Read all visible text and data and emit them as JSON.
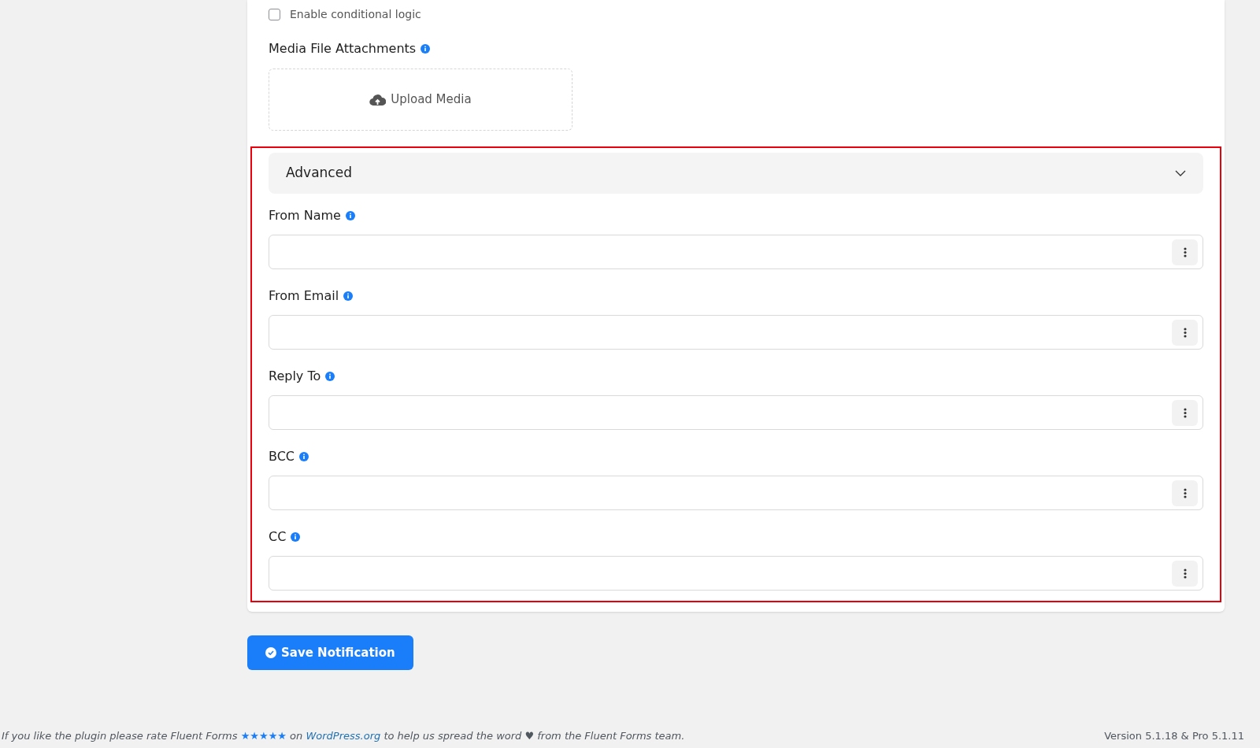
{
  "conditional_logic": {
    "label": "Enable conditional logic",
    "checked": false
  },
  "media_attachments": {
    "label": "Media File Attachments",
    "upload_button": "Upload Media"
  },
  "advanced": {
    "title": "Advanced",
    "expanded": true,
    "fields": [
      {
        "label": "From Name"
      },
      {
        "label": "From Email"
      },
      {
        "label": "Reply To"
      },
      {
        "label": "BCC"
      },
      {
        "label": "CC"
      }
    ]
  },
  "save_button": "Save Notification",
  "footer": {
    "text_before": "If you like the plugin please rate Fluent Forms",
    "stars": "★★★★★",
    "text_middle": "on",
    "link": "WordPress.org",
    "text_after": "to help us spread the word ♥ from the Fluent Forms team.",
    "version": "Version 5.1.18 & Pro 5.1.11"
  }
}
